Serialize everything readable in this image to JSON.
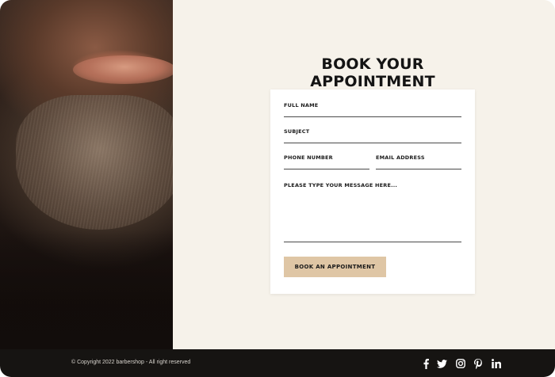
{
  "form": {
    "title": "BOOK YOUR APPOINTMENT",
    "full_name_label": "FULL NAME",
    "subject_label": "SUBJECT",
    "phone_label": "PHONE NUMBER",
    "email_label": "EMAIL ADDRESS",
    "message_label": "PLEASE TYPE YOUR MESSAGE HERE...",
    "submit_label": "BOOK AN APPOINTMENT"
  },
  "footer": {
    "copyright": "© Copyright 2022 barbershop - All right reserved",
    "social": [
      {
        "icon": "facebook-icon"
      },
      {
        "icon": "twitter-icon"
      },
      {
        "icon": "instagram-icon"
      },
      {
        "icon": "pinterest-icon"
      },
      {
        "icon": "linkedin-icon"
      }
    ]
  },
  "colors": {
    "background": "#f6f2ea",
    "button": "#dfc6a5",
    "footer": "#161412",
    "text": "#141414"
  }
}
